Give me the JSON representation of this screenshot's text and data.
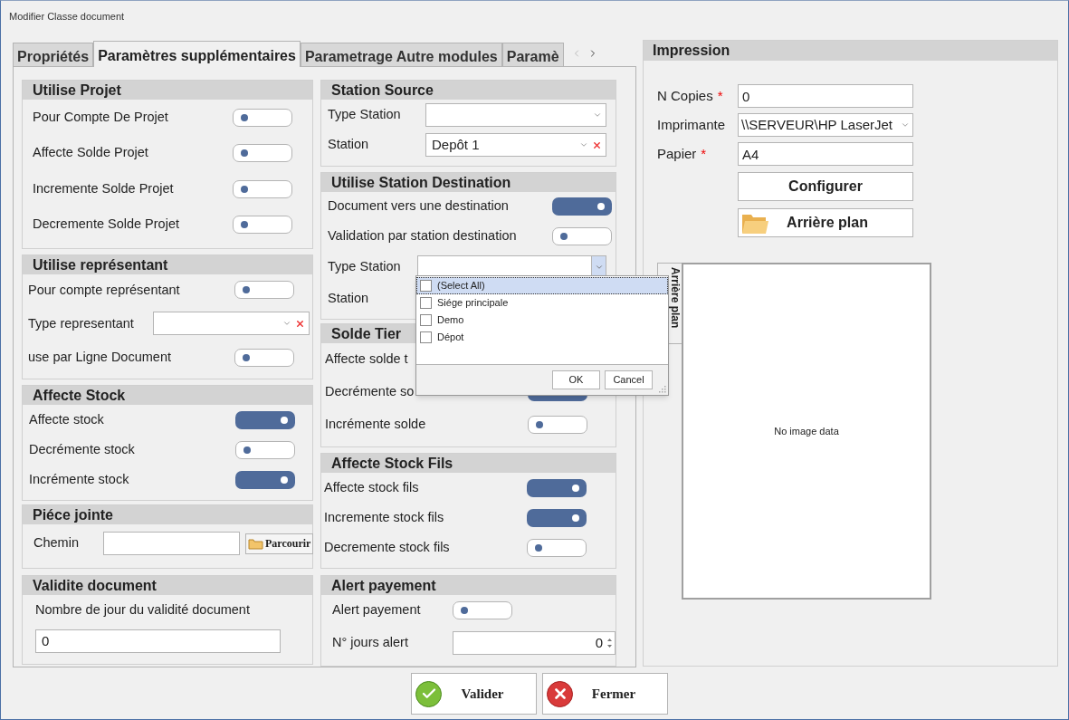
{
  "window": {
    "title": "Modifier Classe document"
  },
  "tabs": [
    {
      "label": "Propriétés",
      "selected": false
    },
    {
      "label": "Paramètres supplémentaires",
      "selected": true
    },
    {
      "label": "Parametrage Autre modules",
      "selected": false
    },
    {
      "label": "Paramè",
      "selected": false
    }
  ],
  "left_column": [
    {
      "title": "Utilise Projet",
      "rows": [
        {
          "kind": "toggle",
          "label": "Pour Compte De Projet",
          "on": false
        },
        {
          "kind": "toggle",
          "label": "Affecte Solde Projet",
          "on": false
        },
        {
          "kind": "toggle",
          "label": "Incremente Solde Projet",
          "on": false
        },
        {
          "kind": "toggle",
          "label": "Decremente Solde Projet",
          "on": false
        }
      ]
    },
    {
      "title": "Utilise représentant",
      "rows": [
        {
          "kind": "toggle",
          "label": "Pour compte représentant",
          "on": false
        },
        {
          "kind": "combo",
          "label": "Type representant",
          "value": "",
          "clearable": true
        },
        {
          "kind": "toggle",
          "label": "use par Ligne Document",
          "on": false
        }
      ]
    },
    {
      "title": "Affecte Stock",
      "rows": [
        {
          "kind": "toggle",
          "label": "Affecte stock",
          "on": true
        },
        {
          "kind": "toggle",
          "label": "Decrémente stock",
          "on": false
        },
        {
          "kind": "toggle",
          "label": "Incrémente stock",
          "on": true
        }
      ]
    },
    {
      "title": "Piéce jointe",
      "rows": [
        {
          "kind": "browse",
          "label": "Chemin",
          "value": "",
          "button": "Parcourir"
        }
      ]
    },
    {
      "title": "Validite document",
      "rows": [
        {
          "kind": "stacked",
          "label": "Nombre de jour du validité document",
          "value": "0"
        }
      ]
    }
  ],
  "middle_column": [
    {
      "title": "Station Source",
      "rows": [
        {
          "kind": "combo",
          "label": "Type Station",
          "value": "",
          "clearable": false
        },
        {
          "kind": "combo",
          "label": "Station",
          "value": "Depôt 1",
          "clearable": true
        }
      ]
    },
    {
      "title": "Utilise Station Destination",
      "rows": [
        {
          "kind": "toggle",
          "label": "Document vers une destination",
          "on": true
        },
        {
          "kind": "toggle",
          "label": "Validation par station destination",
          "on": false
        },
        {
          "kind": "combo",
          "label": "Type Station",
          "value": "",
          "clearable": false,
          "open": true
        },
        {
          "kind": "label",
          "label": "Station"
        }
      ]
    },
    {
      "title": "Solde Tier",
      "rows": [
        {
          "kind": "label",
          "label": "Affecte solde t"
        },
        {
          "kind": "toggle",
          "label": "Decrémente so",
          "on": true
        },
        {
          "kind": "toggle",
          "label": "Incrémente solde",
          "on": false
        }
      ]
    },
    {
      "title": "Affecte Stock Fils",
      "rows": [
        {
          "kind": "toggle",
          "label": "Affecte stock fils",
          "on": true
        },
        {
          "kind": "toggle",
          "label": "Incremente stock fils",
          "on": true
        },
        {
          "kind": "toggle",
          "label": "Decremente stock fils",
          "on": false
        }
      ]
    },
    {
      "title": "Alert payement",
      "rows": [
        {
          "kind": "toggle",
          "label": "Alert payement",
          "on": false
        },
        {
          "kind": "spin",
          "label": "N° jours alert",
          "value": "0"
        }
      ]
    }
  ],
  "dropdown": {
    "items": [
      {
        "label": "(Select All)",
        "checked": false,
        "selected": true
      },
      {
        "label": "Siége principale",
        "checked": false,
        "selected": false
      },
      {
        "label": "Demo",
        "checked": false,
        "selected": false
      },
      {
        "label": "Dépot",
        "checked": false,
        "selected": false
      }
    ],
    "buttons": [
      "OK",
      "Cancel"
    ]
  },
  "impression": {
    "title": "Impression",
    "fields": [
      {
        "kind": "text",
        "label": "N Copies",
        "required_mark": "*",
        "value": "0"
      },
      {
        "kind": "combo",
        "label": "Imprimante",
        "value": "\\\\SERVEUR\\HP LaserJet"
      },
      {
        "kind": "text",
        "label": "Papier",
        "required_mark": "*",
        "value": "A4"
      }
    ],
    "configure_button": "Configurer",
    "background_button": "Arrière plan",
    "image_tab": "Arrière plan",
    "image_text": "No image data"
  },
  "footer_buttons": [
    {
      "kind": "ok",
      "label": "Valider"
    },
    {
      "kind": "cancel",
      "label": "Fermer"
    }
  ]
}
